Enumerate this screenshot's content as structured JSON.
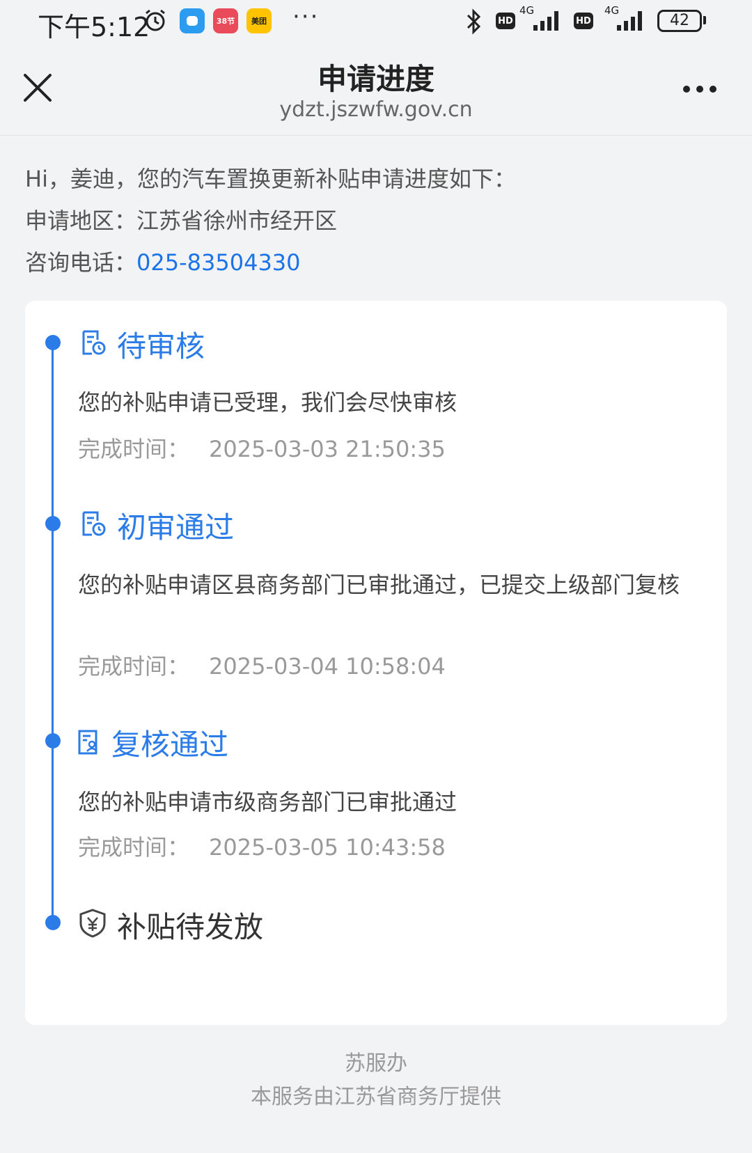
{
  "status_bar": {
    "time": "下午5:12",
    "apps": [
      {
        "icon": "chat-app-icon",
        "color": "#2c9cf0",
        "label": ""
      },
      {
        "icon": "shopping-app-icon",
        "color": "#e94b5b",
        "label": "38节"
      },
      {
        "icon": "meituan-app-icon",
        "color": "#ffc300",
        "label": "美团"
      }
    ],
    "more": "···",
    "hd_label": "HD",
    "network_label": "4G",
    "battery": "42"
  },
  "header": {
    "title": "申请进度",
    "url": "ydzt.jszwfw.gov.cn"
  },
  "info": {
    "greeting": "Hi，姜迪，您的汽车置换更新补贴申请进度如下：",
    "region_label": "申请地区：",
    "region_value": "江苏省徐州市经开区",
    "phone_label": "咨询电话：",
    "phone_value": "025-83504330"
  },
  "timeline": {
    "time_label": "完成时间：",
    "steps": [
      {
        "title": "待审核",
        "desc": "您的补贴申请已受理，我们会尽快审核",
        "time": "2025-03-03 21:50:35"
      },
      {
        "title": "初审通过",
        "desc": "您的补贴申请区县商务部门已审批通过，已提交上级部门复核",
        "time": "2025-03-04 10:58:04"
      },
      {
        "title": "复核通过",
        "desc": "您的补贴申请市级商务部门已审批通过",
        "time": "2025-03-05 10:43:58"
      },
      {
        "title": "补贴待发放"
      }
    ]
  },
  "footer": {
    "brand": "苏服办",
    "provider": "本服务由江苏省商务厅提供"
  },
  "colors": {
    "accent": "#2b7ce9",
    "link": "#1a73e8"
  }
}
